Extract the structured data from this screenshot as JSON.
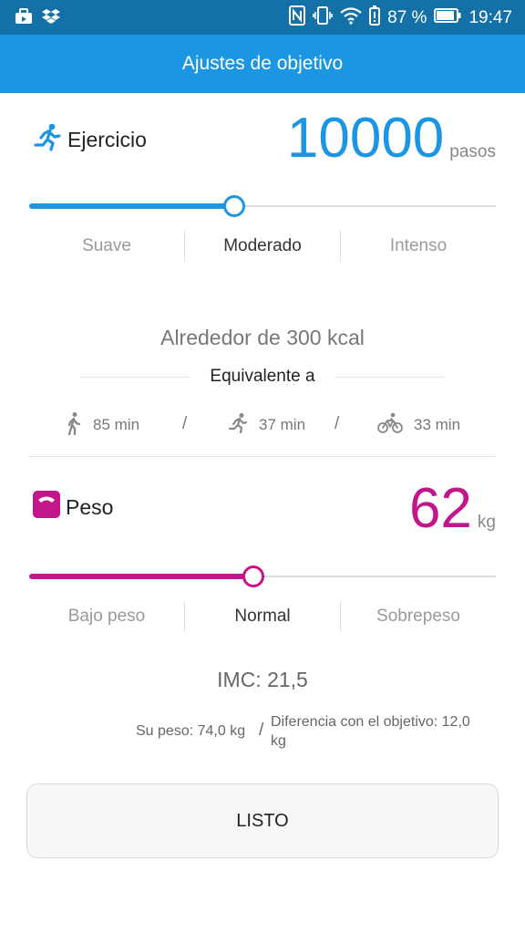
{
  "status_bar": {
    "battery_percent": "87 %",
    "time": "19:47"
  },
  "app_bar": {
    "title": "Ajustes de objetivo"
  },
  "exercise": {
    "label": "Ejercicio",
    "value": "10000",
    "unit": "pasos",
    "slider_level": 0.44,
    "accent": "#1b96e3",
    "levels": [
      "Suave",
      "Moderado",
      "Intenso"
    ],
    "active_level": "Moderado",
    "calories": "Alrededor de 300 kcal",
    "equivalent_label": "Equivalente a",
    "activities": [
      {
        "icon": "walk-icon",
        "time": "85 min"
      },
      {
        "icon": "run-icon",
        "time": "37 min"
      },
      {
        "icon": "bike-icon",
        "time": "33 min"
      }
    ],
    "separator": "/"
  },
  "weight": {
    "label": "Peso",
    "value": "62",
    "unit": "kg",
    "slider_level": 0.48,
    "accent": "#c4168b",
    "levels": [
      "Bajo peso",
      "Normal",
      "Sobrepeso"
    ],
    "active_level": "Normal",
    "bmi": "IMC: 21,5",
    "current_weight": "Su peso: 74,0 kg",
    "separator": "/",
    "difference_line1": "Diferencia con el objetivo: 12,0",
    "difference_line2": "kg"
  },
  "done_button": {
    "label": "LISTO"
  }
}
